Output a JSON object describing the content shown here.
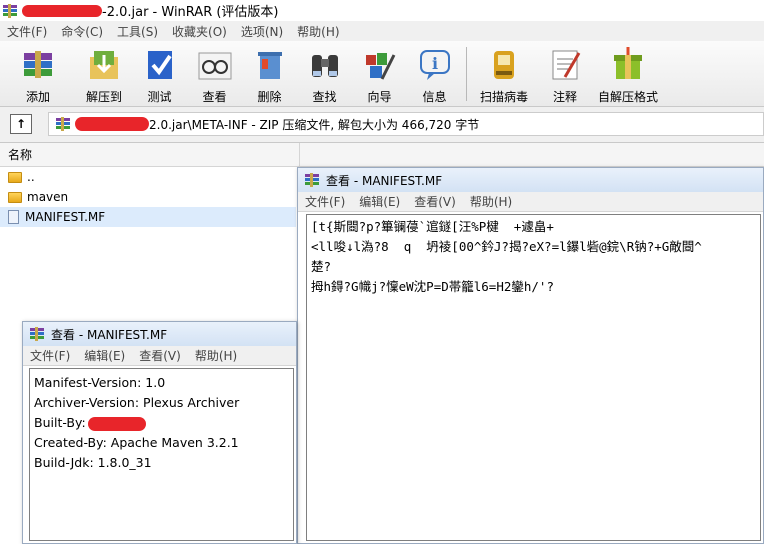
{
  "window": {
    "title_suffix": "-2.0.jar - WinRAR (评估版本)"
  },
  "menu": [
    "文件(F)",
    "命令(C)",
    "工具(S)",
    "收藏夹(O)",
    "选项(N)",
    "帮助(H)"
  ],
  "toolbar": [
    {
      "label": "添加",
      "icon": "books-add-icon",
      "color": "#7b5fc4"
    },
    {
      "label": "解压到",
      "icon": "extract-folder-icon",
      "color": "#6fae3d"
    },
    {
      "label": "测试",
      "icon": "test-check-icon",
      "color": "#2a62c9"
    },
    {
      "label": "查看",
      "icon": "glasses-view-icon",
      "color": "#b8b8b8"
    },
    {
      "label": "删除",
      "icon": "delete-bin-icon",
      "color": "#5a8fd0"
    },
    {
      "label": "查找",
      "icon": "binoculars-find-icon",
      "color": "#4a4a4a"
    },
    {
      "label": "向导",
      "icon": "wizard-icon",
      "color": "#c0392b"
    },
    {
      "label": "信息",
      "icon": "info-icon",
      "color": "#3b76c4"
    },
    {
      "label": "扫描病毒",
      "icon": "virus-scan-icon",
      "color": "#d9a21f"
    },
    {
      "label": "注释",
      "icon": "comment-pen-icon",
      "color": "#e4e4e4"
    },
    {
      "label": "自解压格式",
      "icon": "sfx-box-icon",
      "color": "#8cbf2a"
    }
  ],
  "address": {
    "path_suffix": "2.0.jar\\META-INF - ZIP 压缩文件, 解包大小为 466,720 字节"
  },
  "column_header": "名称",
  "files": [
    {
      "name": "..",
      "type": "folder"
    },
    {
      "name": "maven",
      "type": "folder"
    },
    {
      "name": "MANIFEST.MF",
      "type": "file"
    }
  ],
  "viewer_garbled": {
    "title": "查看 - MANIFEST.MF",
    "menu": [
      "文件(F)",
      "编辑(E)",
      "查看(V)",
      "帮助(H)"
    ],
    "lines": [
      "[t{斯閸?p?篳镧葠`逭鐩[汪%P楗  +遽畠+",
      "<ll唆↓l溈?8  q  坍祾[00^鈐J?揭?eX?=l鑤l砦@鋎\\R钠?+G敵閸^",
      "楚?",
      "拇h鍀?G幟j?懍eW沈P=D帯籠l6=H2鑾h/'?"
    ]
  },
  "viewer_manifest": {
    "title": "查看 - MANIFEST.MF",
    "menu": [
      "文件(F)",
      "编辑(E)",
      "查看(V)",
      "帮助(H)"
    ],
    "lines": [
      "Manifest-Version: 1.0",
      "Archiver-Version: Plexus Archiver",
      "Built-By:",
      "Created-By: Apache Maven 3.2.1",
      "Build-Jdk: 1.8.0_31"
    ]
  }
}
